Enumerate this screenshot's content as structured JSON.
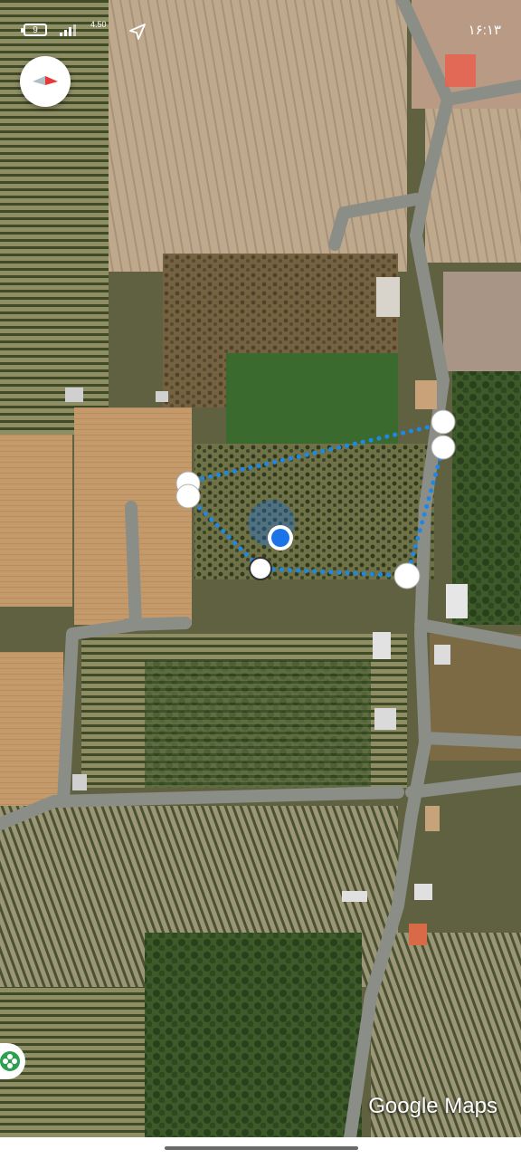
{
  "status_bar": {
    "time": "۱۶:۱۳",
    "battery": "9",
    "net_speed": "4.50",
    "icons": [
      "battery-icon",
      "signal-icon",
      "network-speed",
      "navigation-arrow-icon"
    ]
  },
  "map": {
    "type": "satellite",
    "attribution": "Google Maps",
    "compass_icon": "compass-icon",
    "side_button_icon": "flower-icon",
    "colors": {
      "measure_line": "#1e88e5",
      "location_dot": "#1a73e8",
      "vertex_handle": "#ffffff",
      "road": "#8b8d87"
    }
  }
}
